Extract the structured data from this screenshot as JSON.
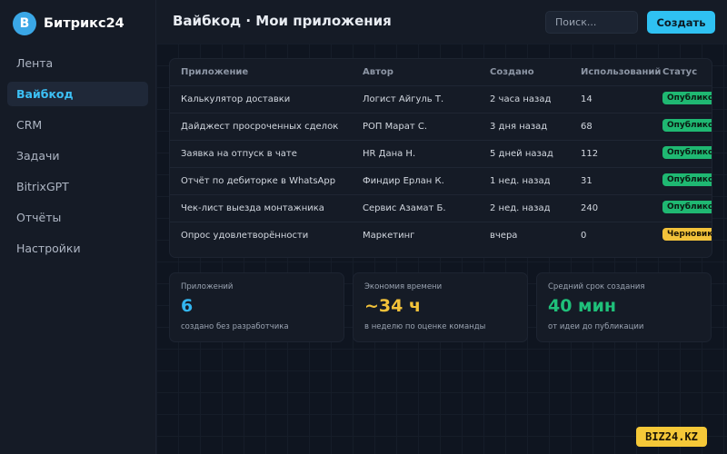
{
  "brand": {
    "logo_letter": "B",
    "name": "Битрикс24"
  },
  "sidebar": {
    "items": [
      {
        "label": "Лента",
        "active": false
      },
      {
        "label": "Вайбкод",
        "active": true
      },
      {
        "label": "CRM",
        "active": false
      },
      {
        "label": "Задачи",
        "active": false
      },
      {
        "label": "BitrixGPT",
        "active": false
      },
      {
        "label": "Отчёты",
        "active": false
      },
      {
        "label": "Настройки",
        "active": false
      }
    ]
  },
  "header": {
    "title": "Вайбкод · Мои приложения",
    "search_placeholder": "Поиск...",
    "create_label": "Создать"
  },
  "table": {
    "columns": [
      "Приложение",
      "Автор",
      "Создано",
      "Использований",
      "Статус"
    ],
    "rows": [
      {
        "app": "Калькулятор доставки",
        "author": "Логист Айгуль Т.",
        "created": "2 часа назад",
        "uses": "14",
        "status": "Опубликовано",
        "status_type": "published"
      },
      {
        "app": "Дайджест просроченных сделок",
        "author": "РОП Марат С.",
        "created": "3 дня назад",
        "uses": "68",
        "status": "Опубликовано",
        "status_type": "published"
      },
      {
        "app": "Заявка на отпуск в чате",
        "author": "HR Дана Н.",
        "created": "5 дней назад",
        "uses": "112",
        "status": "Опубликовано",
        "status_type": "published"
      },
      {
        "app": "Отчёт по дебиторке в WhatsApp",
        "author": "Финдир Ерлан К.",
        "created": "1 нед. назад",
        "uses": "31",
        "status": "Опубликовано",
        "status_type": "published"
      },
      {
        "app": "Чек-лист выезда монтажника",
        "author": "Сервис Азамат Б.",
        "created": "2 нед. назад",
        "uses": "240",
        "status": "Опубликовано",
        "status_type": "published"
      },
      {
        "app": "Опрос удовлетворённости",
        "author": "Маркетинг",
        "created": "вчера",
        "uses": "0",
        "status": "Черновик",
        "status_type": "draft"
      }
    ]
  },
  "stats": [
    {
      "label": "Приложений",
      "value": "6",
      "sub": "создано без разработчика",
      "color": "#33b6f0"
    },
    {
      "label": "Экономия времени",
      "value": "~34 ч",
      "sub": "в неделю по оценке команды",
      "color": "#f2c23a"
    },
    {
      "label": "Средний срок создания",
      "value": "40 мин",
      "sub": "от идеи до публикации",
      "color": "#1fc07a"
    }
  ],
  "watermark": "BIZ24.KZ",
  "colors": {
    "accent": "#2fc1f2",
    "published": "#1fb872",
    "draft": "#f2c23a",
    "background": "#0f1520",
    "panel": "#151b26"
  }
}
